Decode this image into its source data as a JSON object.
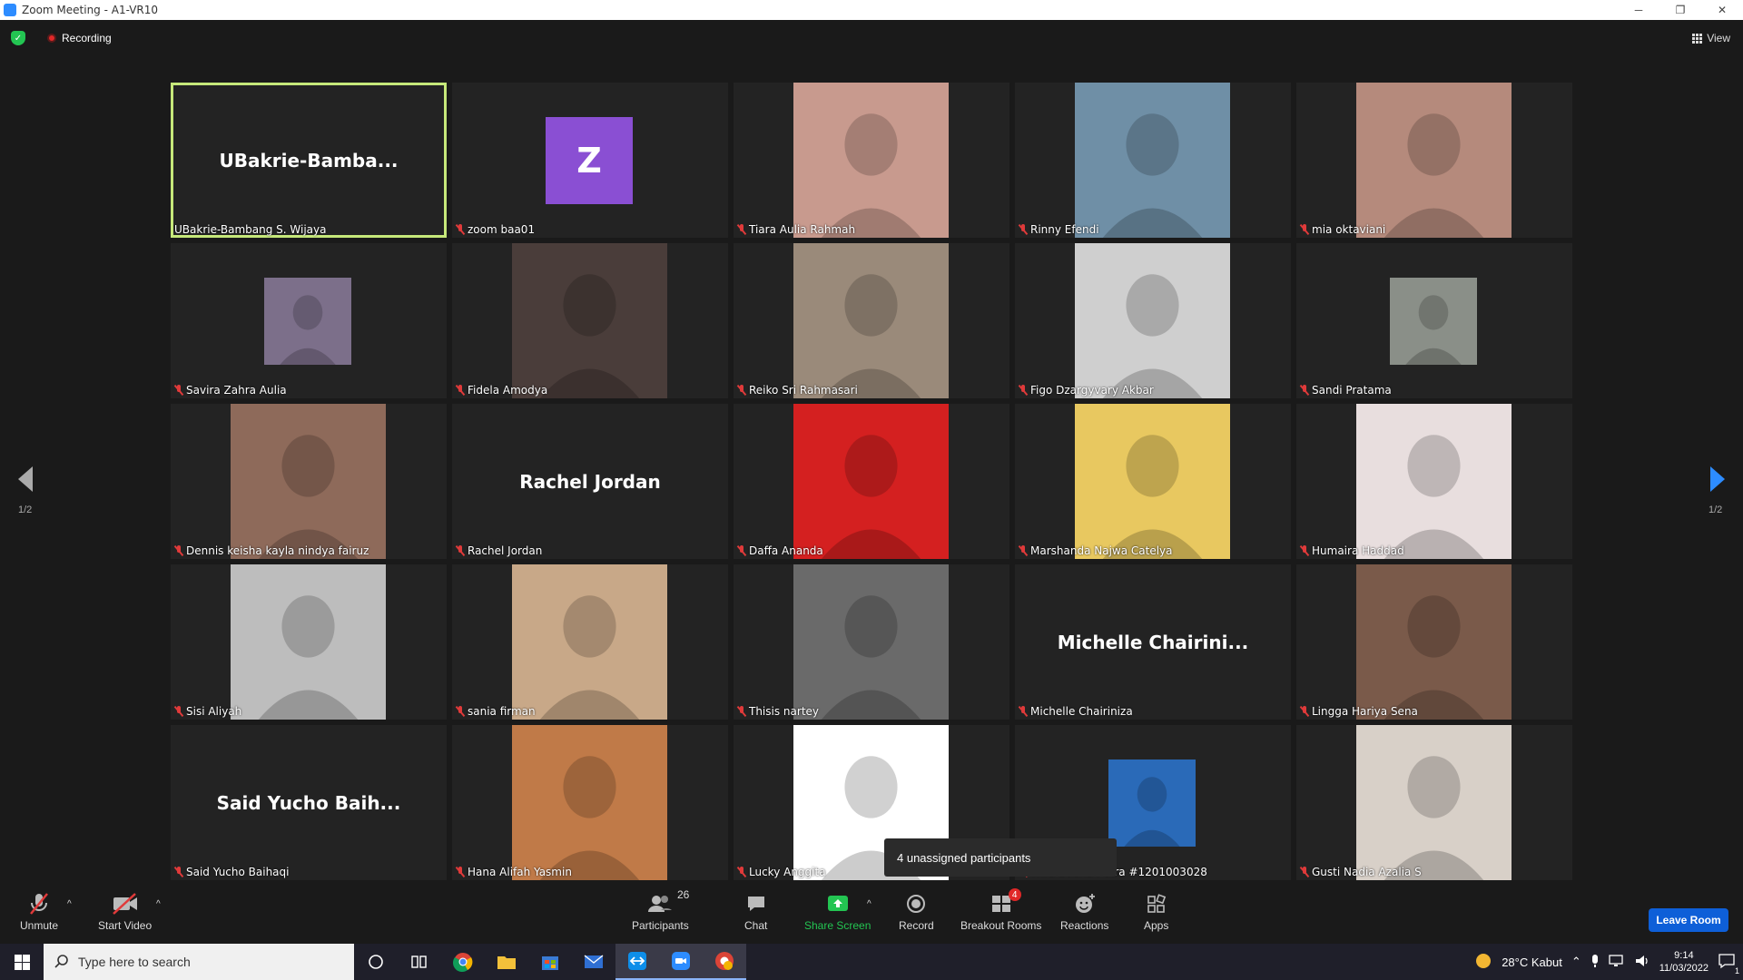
{
  "window": {
    "title": "Zoom Meeting - A1-VR10",
    "minimize": "─",
    "restore": "❐",
    "close": "✕"
  },
  "topbar": {
    "recording_label": "Recording",
    "view_label": "View"
  },
  "tiles": [
    {
      "name": "UBakrie-Bambang S. Wijaya",
      "big": "UBakrie-Bamba...",
      "kind": "text",
      "active": true,
      "muted": false
    },
    {
      "name": "zoom baa01",
      "big": "Z",
      "kind": "avatar",
      "muted": true
    },
    {
      "name": "Tiara Aulia Rahmah",
      "kind": "photo",
      "bg": "#c89a8e",
      "muted": true
    },
    {
      "name": "Rinny Efendi",
      "kind": "photo",
      "bg": "#6f8fa6",
      "muted": true
    },
    {
      "name": "mia oktaviani",
      "kind": "photo",
      "bg": "#b58a7c",
      "muted": true
    },
    {
      "name": "Savira Zahra Aulia",
      "kind": "photo-small",
      "bg": "#7c6f8a",
      "muted": true
    },
    {
      "name": "Fidela Amodya",
      "kind": "photo",
      "bg": "#4a3d3a",
      "muted": true
    },
    {
      "name": "Reiko Sri Rahmasari",
      "kind": "photo",
      "bg": "#9a8a7a",
      "muted": true
    },
    {
      "name": "Figo Dzargyvary Akbar",
      "kind": "photo",
      "bg": "#cfcfcf",
      "muted": true
    },
    {
      "name": "Sandi Pratama",
      "kind": "photo-small",
      "bg": "#8a8f88",
      "muted": true
    },
    {
      "name": "Dennis keisha kayla nindya fairuz",
      "kind": "photo",
      "bg": "#8e6a5a",
      "muted": true
    },
    {
      "name": "Rachel Jordan",
      "big": "Rachel Jordan",
      "kind": "text",
      "muted": true
    },
    {
      "name": "Daffa Ananda",
      "kind": "photo",
      "bg": "#d42020",
      "muted": true
    },
    {
      "name": "Marshanda Najwa Catelya",
      "kind": "photo",
      "bg": "#e8c860",
      "muted": true
    },
    {
      "name": "Humaira Haddad",
      "kind": "photo",
      "bg": "#e8dede",
      "muted": true
    },
    {
      "name": "Sisi Aliyah",
      "kind": "photo",
      "bg": "#bdbdbd",
      "muted": true
    },
    {
      "name": "sania firman",
      "kind": "photo",
      "bg": "#c8a888",
      "muted": true
    },
    {
      "name": "Thisis nartey",
      "kind": "photo",
      "bg": "#6a6a6a",
      "muted": true
    },
    {
      "name": "Michelle Chairiniza",
      "big": "Michelle  Chairini...",
      "kind": "text",
      "muted": true
    },
    {
      "name": "Lingga Hariya Sena",
      "kind": "photo",
      "bg": "#7a5a4a",
      "muted": true
    },
    {
      "name": "Said Yucho Baihaqi",
      "big": "Said  Yucho  Baih...",
      "kind": "text",
      "muted": true
    },
    {
      "name": "Hana Alifah Yasmin",
      "kind": "photo",
      "bg": "#c07a48",
      "muted": true
    },
    {
      "name": "Lucky Anggita",
      "kind": "photo",
      "bg": "#ffffff",
      "muted": true
    },
    {
      "name": "Wira Buana Putra #1201003028",
      "kind": "photo-small",
      "bg": "#2a6ab8",
      "muted": true
    },
    {
      "name": "Gusti Nadia Azalia S",
      "kind": "photo",
      "bg": "#d8d0c8",
      "muted": true
    }
  ],
  "paging": {
    "left": "1/2",
    "right": "1/2"
  },
  "toast": "4 unassigned participants",
  "toolbar": {
    "unmute": "Unmute",
    "start_video": "Start Video",
    "participants": "Participants",
    "participants_count": "26",
    "chat": "Chat",
    "share_screen": "Share Screen",
    "record": "Record",
    "breakout_rooms": "Breakout Rooms",
    "breakout_badge": "4",
    "reactions": "Reactions",
    "apps": "Apps",
    "leave": "Leave Room"
  },
  "taskbar": {
    "search_placeholder": "Type here to search",
    "weather": "28°C  Kabut",
    "time": "9:14",
    "date": "11/03/2022",
    "notifications": "1"
  },
  "colors": {
    "accent": "#2d8cff",
    "active_border": "#c6e87a",
    "leave": "#0e5fd8",
    "share_green": "#23c552"
  }
}
